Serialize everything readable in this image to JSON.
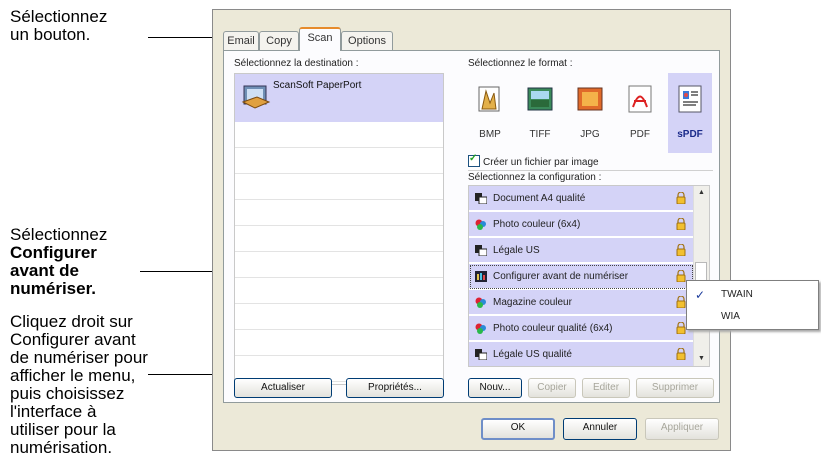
{
  "callouts": {
    "select_button": [
      "Sélectionnez",
      "un bouton."
    ],
    "select_config": [
      "Sélectionnez",
      "Configurer",
      "avant de",
      "numériser."
    ],
    "right_click": [
      "Cliquez droit sur",
      "Configurer avant",
      "de numériser pour",
      "afficher le menu,",
      "puis choisissez",
      "l'interface à",
      "utiliser pour la",
      "numérisation."
    ]
  },
  "tabs": [
    "Email",
    "Copy",
    "Scan",
    "Options"
  ],
  "active_tab": "Scan",
  "labels": {
    "destination": "Sélectionnez la destination :",
    "format": "Sélectionnez le format :",
    "configuration": "Sélectionnez la configuration :"
  },
  "destinations": [
    {
      "name": "ScanSoft PaperPort",
      "icon": "paperport-icon",
      "selected": true
    }
  ],
  "formats": [
    {
      "label": "BMP",
      "icon": "bmp-icon",
      "selected": false
    },
    {
      "label": "TIFF",
      "icon": "tiff-icon",
      "selected": false
    },
    {
      "label": "JPG",
      "icon": "jpg-icon",
      "selected": false
    },
    {
      "label": "PDF",
      "icon": "pdf-icon",
      "selected": false
    },
    {
      "label": "sPDF",
      "icon": "spdf-icon",
      "selected": true
    }
  ],
  "checkbox": {
    "label": "Créer un fichier par image",
    "checked": true
  },
  "configurations": [
    {
      "label": "Document A4 qualité",
      "icon": "bw-document-icon"
    },
    {
      "label": "Photo couleur (6x4)",
      "icon": "color-photo-icon"
    },
    {
      "label": "Légale US",
      "icon": "bw-document-icon"
    },
    {
      "label": "Configurer avant de numériser",
      "icon": "configure-icon",
      "focused": true
    },
    {
      "label": "Magazine couleur",
      "icon": "color-photo-icon"
    },
    {
      "label": "Photo couleur qualité (6x4)",
      "icon": "color-photo-icon"
    },
    {
      "label": "Légale US qualité",
      "icon": "bw-document-icon"
    }
  ],
  "buttons": {
    "refresh": "Actualiser",
    "properties": "Propriétés...",
    "new": "Nouv...",
    "copy": "Copier",
    "edit": "Editer",
    "delete": "Supprimer",
    "ok": "OK",
    "cancel": "Annuler",
    "apply": "Appliquer"
  },
  "context_menu": [
    {
      "label": "TWAIN",
      "checked": true
    },
    {
      "label": "WIA",
      "checked": false
    }
  ],
  "colors": {
    "selection": "#d4d3f7",
    "tab_accent": "#e68b2c",
    "dialog_bg": "#ece9d8"
  }
}
